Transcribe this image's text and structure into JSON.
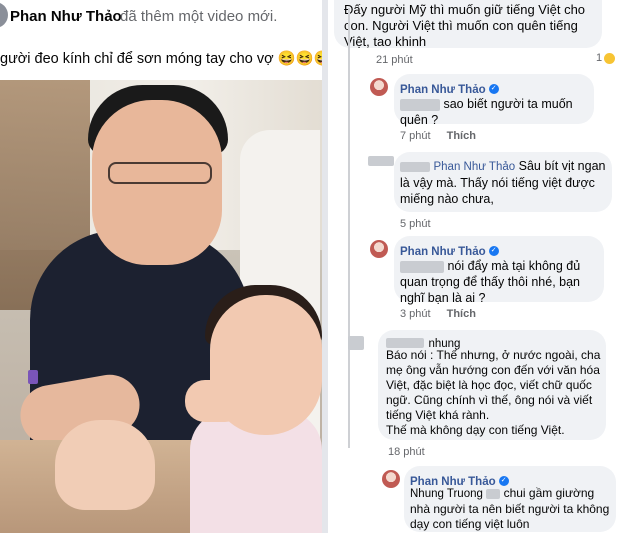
{
  "post": {
    "author": "Phan Như Thảo",
    "action": "đã thêm một video mới.",
    "caption": "gười đeo kính chỉ để sơn móng tay cho vợ 😆😆😆"
  },
  "comments": {
    "top": {
      "text": "Đấy người Mỹ thì muốn giữ tiếng Việt cho con. Người Việt thì muốn con quên tiếng Việt, tao khinh",
      "time": "21 phút",
      "reaction_count": "1"
    },
    "c1": {
      "author": "Phan Như Thảo",
      "text": "sao biết người ta muốn quên ?",
      "time": "7 phút",
      "like": "Thích"
    },
    "c2": {
      "author": "Phan Như Thảo",
      "text": "Sâu bít vịt ngan là vậy mà. Thấy nói tiếng việt được miếng nào chưa,",
      "time": "5 phút"
    },
    "c3": {
      "author": "Phan Như Thảo",
      "text": "nói đẩy mà tại không đủ quan trọng để thấy thôi nhé, bạn nghĩ bạn là ai ?",
      "time": "3 phút",
      "like": "Thích"
    },
    "c4": {
      "author": "nhung",
      "line1": "Báo nói : Thế nhưng, ở nước ngoài, cha mẹ ông vẫn hướng con đến với văn hóa Việt, đặc biệt là học đọc, viết chữ quốc ngữ. Cũng chính vì thế, ông nói và viết tiếng Việt khá rành.",
      "line2": "Thế mà không dạy con tiếng Việt.",
      "time": "18 phút"
    },
    "c5": {
      "author": "Phan Như Thảo",
      "mention": "Nhung Truong",
      "text": "chui gầm giường nhà người ta nên biết người ta không dạy con tiếng việt luôn"
    }
  },
  "colors": {
    "link": "#385898",
    "bubble": "#f0f2f5",
    "meta": "#65676b",
    "verified": "#1877f2"
  }
}
